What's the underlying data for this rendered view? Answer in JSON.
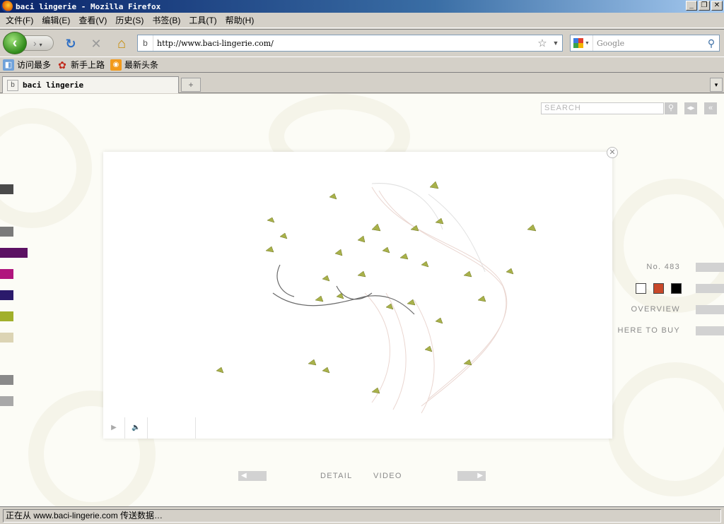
{
  "window": {
    "title": "baci lingerie - Mozilla Firefox",
    "min": "_",
    "max": "❐",
    "close": "✕"
  },
  "menu": [
    "文件(F)",
    "编辑(E)",
    "查看(V)",
    "历史(S)",
    "书签(B)",
    "工具(T)",
    "帮助(H)"
  ],
  "nav": {
    "back": "‹",
    "forward": "›",
    "reload": "↻",
    "stop": "✕",
    "home": "⌂",
    "url": "http://www.baci-lingerie.com/",
    "search_placeholder": "Google"
  },
  "bookmarks": [
    {
      "label": "访问最多",
      "icon": "folder-icon"
    },
    {
      "label": "新手上路",
      "icon": "firefox-icon"
    },
    {
      "label": "最新头条",
      "icon": "rss-icon"
    }
  ],
  "tab": {
    "label": "baci lingerie",
    "new_tab": "+"
  },
  "site": {
    "search_placeholder": "SEARCH",
    "product_no": "No. 483",
    "overview": "OVERVIEW",
    "where_to_buy": "HERE TO BUY",
    "detail": "DETAIL",
    "video": "VIDEO",
    "swatch_colors": [
      "#ffffff",
      "#c8482a",
      "#000000"
    ],
    "left_swatches": [
      "#4a4a4a",
      "#7a7a7a",
      "#5c1163",
      "#b0157d",
      "#2b1a6b",
      "#a1b02b",
      "#dcd4b4",
      "#8a8a8a",
      "#a8a8a8"
    ]
  },
  "video": {
    "close": "✕",
    "play": "▶",
    "volume": "🔈"
  },
  "status": "正在从 www.baci-lingerie.com 传送数据…"
}
